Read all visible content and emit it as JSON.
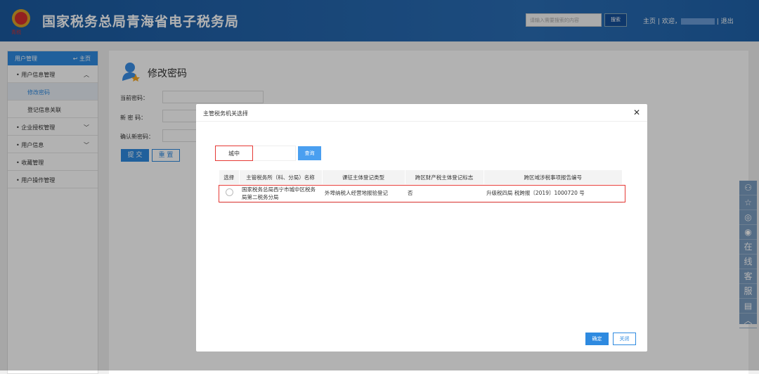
{
  "header": {
    "title": "国家税务总局青海省电子税务局",
    "search_placeholder": "请输入需要搜索的内容",
    "search_button": "搜索",
    "home": "主页",
    "sep": "|",
    "welcome": "欢迎，",
    "logout": "退出"
  },
  "sidebar": {
    "title": "用户管理",
    "home": "主页",
    "items": [
      {
        "label": "用户信息管理",
        "icon": "chevron-up"
      },
      {
        "label": "修改密码",
        "sub": true,
        "active": true
      },
      {
        "label": "登记信息关联",
        "sub": true
      },
      {
        "label": "企业授权管理",
        "icon": "chevron-down"
      },
      {
        "label": "用户信息",
        "icon": "chevron-down"
      },
      {
        "label": "收藏管理"
      },
      {
        "label": "用户操作管理"
      }
    ]
  },
  "page": {
    "title": "修改密码",
    "current_pw": "当前密码：",
    "new_pw": "新 密 码：",
    "confirm_pw": "确认新密码：",
    "submit": "提 交",
    "reset": "重 置"
  },
  "float_bar": {
    "service": [
      "在",
      "线",
      "客",
      "服"
    ]
  },
  "modal": {
    "title": "主管税务机关选择",
    "query_value": "城中",
    "query_button": "查询",
    "columns": [
      "选择",
      "主管税务所（科、分局）名称",
      "课征主体登记类型",
      "跨区财产税主体登记标志",
      "跨区域涉税事项报告编号"
    ],
    "rows": [
      {
        "name": "国家税务总局西宁市城中区税务局第二税务分局",
        "type": "外埠纳税人经营地报验登记",
        "flag": "否",
        "report": "升级税四局 税跨报〔2019〕1000720 号"
      }
    ],
    "ok": "确定",
    "close": "关闭"
  }
}
